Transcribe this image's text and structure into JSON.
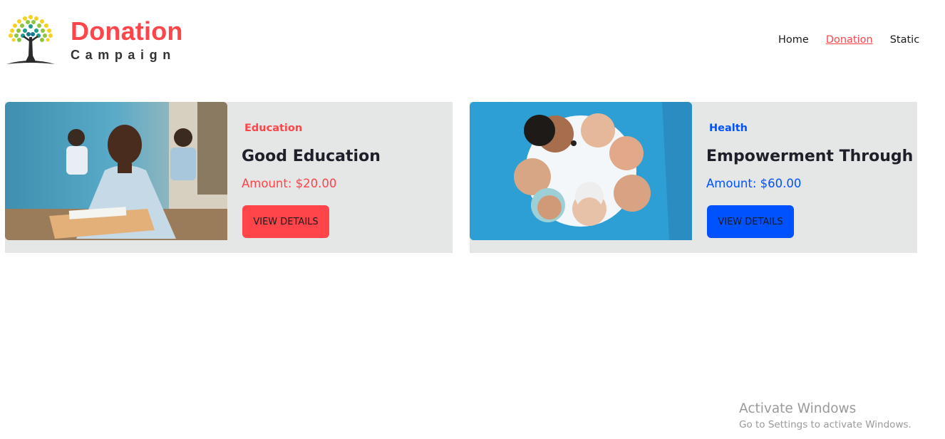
{
  "header": {
    "brand_title": "Donation",
    "brand_subtitle": "Campaign",
    "nav": [
      {
        "label": "Home",
        "active": false
      },
      {
        "label": "Donation",
        "active": true
      },
      {
        "label": "Static",
        "active": false
      }
    ]
  },
  "cards": [
    {
      "category": "Education",
      "title": "Good Education",
      "amount": "Amount: $20.00",
      "button": "VIEW DETAILS",
      "accent_color": "#ff444a",
      "card_bg": "#e5e6e6"
    },
    {
      "category": "Health",
      "title": "Empowerment Through",
      "amount": "Amount: $60.00",
      "button": "VIEW DETAILS",
      "accent_color": "#0052ff",
      "card_bg": "#e5e6e6"
    }
  ],
  "watermark": {
    "title": "Activate Windows",
    "subtitle": "Go to Settings to activate Windows."
  },
  "colors": {
    "brand_red": "#ff444a",
    "brand_blue": "#0052ff"
  }
}
